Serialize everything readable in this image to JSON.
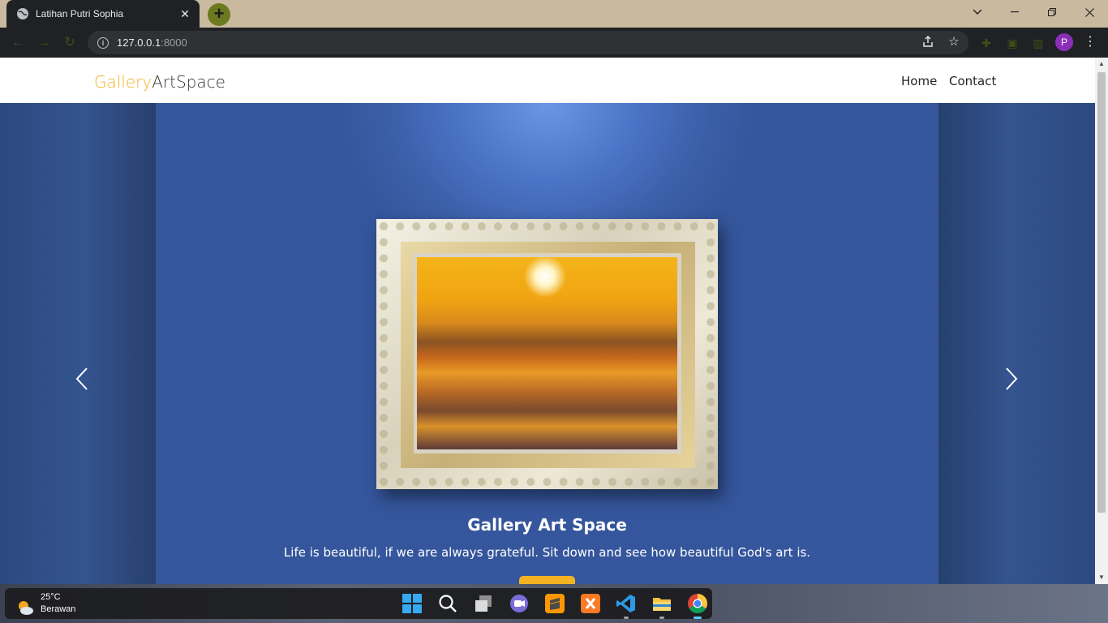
{
  "browser": {
    "tab_title": "Latihan Putri Sophia",
    "url_host": "127.0.0.1",
    "url_port": ":8000",
    "profile_initial": "P"
  },
  "site": {
    "brand_part1": "Gallery",
    "brand_part2": "ArtSpace",
    "nav": [
      "Home",
      "Contact"
    ],
    "brand_color": "#f4b223"
  },
  "hero": {
    "title": "Gallery Art Space",
    "text": "Life is beautiful, if we are always grateful. Sit down and see how beautiful God's art is."
  },
  "taskbar": {
    "temperature": "25°C",
    "weather": "Berawan",
    "apps": [
      "start-icon",
      "search-icon",
      "task-view-icon",
      "teams-chat-icon",
      "sublime-text-icon",
      "xampp-icon",
      "vscode-icon",
      "file-explorer-icon",
      "chrome-icon"
    ]
  }
}
